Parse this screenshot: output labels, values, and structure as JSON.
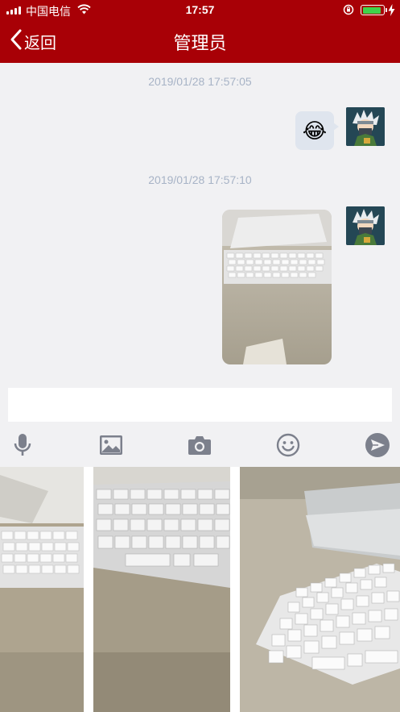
{
  "status_bar": {
    "carrier": "中国电信",
    "time": "17:57"
  },
  "nav": {
    "back_label": "返回",
    "title": "管理员"
  },
  "messages": [
    {
      "timestamp": "2019/01/28 17:57:05",
      "type": "emoji",
      "content": "😂"
    },
    {
      "timestamp": "2019/01/28 17:57:10",
      "type": "photo",
      "content": "keyboard-photo"
    }
  ],
  "composer": {
    "value": "",
    "placeholder": ""
  },
  "toolbar": {
    "icons": [
      "microphone-icon",
      "image-icon",
      "camera-icon",
      "smiley-icon",
      "send-icon"
    ]
  },
  "colors": {
    "header": "#a80006",
    "background": "#f1f1f3",
    "timestamp": "#a7b3c6",
    "bubble": "#dfe5ee",
    "icon": "#7c808c"
  }
}
